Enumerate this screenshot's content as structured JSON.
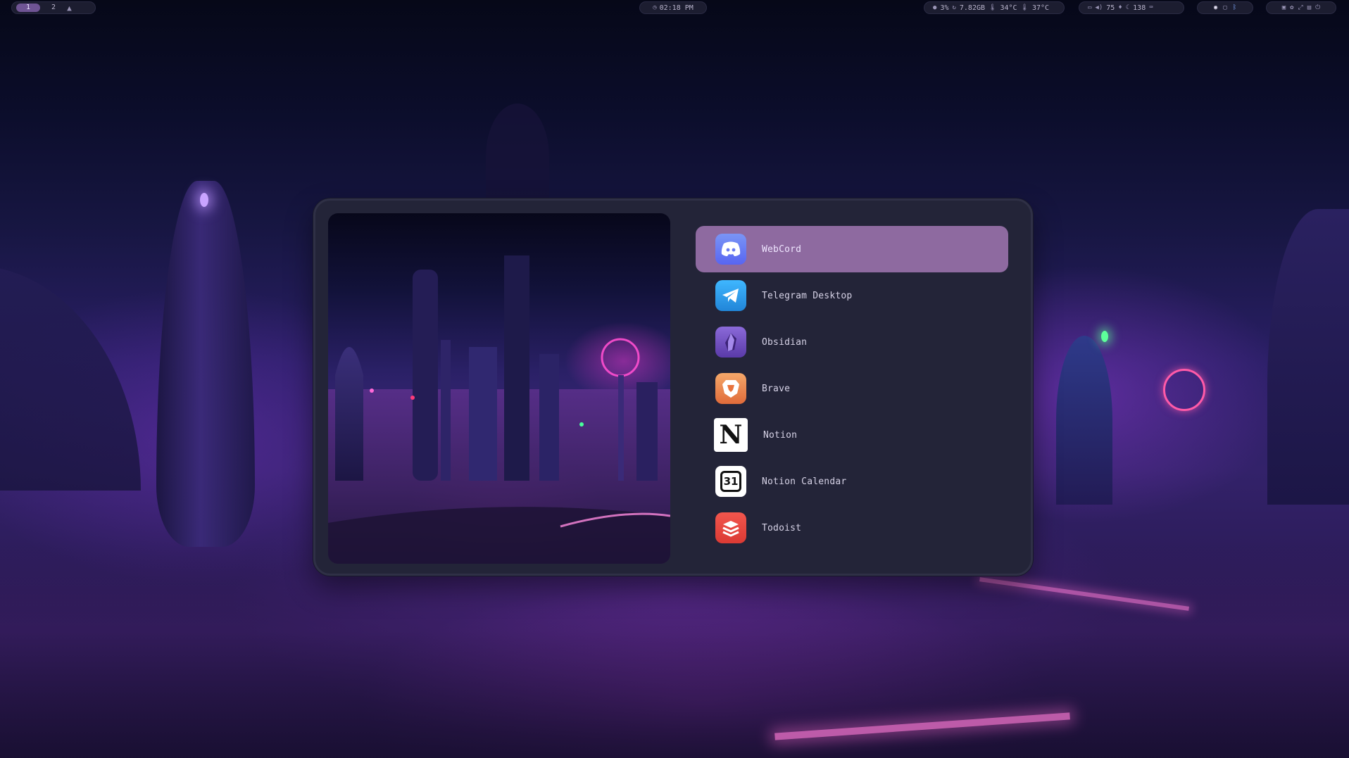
{
  "topbar": {
    "workspaces": [
      {
        "label": "1",
        "active": true
      },
      {
        "label": "2",
        "active": false
      }
    ],
    "workspace_extra_icon": "arch-logo-icon",
    "clock": "02:18 PM",
    "system_stats": {
      "cpu": "3%",
      "memory": "7.82GB",
      "temp_1": "34°C",
      "temp_2": "37°C"
    },
    "volume": "75",
    "brightness_value": "138",
    "tray_icons": [
      "discord-icon",
      "display-icon",
      "bluetooth-icon"
    ],
    "power_icons": [
      "lock-icon",
      "settings-icon",
      "screenshot-icon",
      "files-icon",
      "power-icon"
    ]
  },
  "launcher": {
    "selected_index": 0,
    "apps": [
      {
        "name": "WebCord",
        "icon": "discord-icon"
      },
      {
        "name": "Telegram Desktop",
        "icon": "telegram-icon"
      },
      {
        "name": "Obsidian",
        "icon": "obsidian-icon"
      },
      {
        "name": "Brave",
        "icon": "brave-icon"
      },
      {
        "name": "Notion",
        "icon": "notion-icon"
      },
      {
        "name": "Notion Calendar",
        "icon": "notion-calendar-icon",
        "icon_text": "31"
      },
      {
        "name": "Todoist",
        "icon": "todoist-icon"
      }
    ]
  },
  "colors": {
    "accent": "#8e6aa0",
    "panel": "#232438",
    "bar": "#1c1d30"
  }
}
